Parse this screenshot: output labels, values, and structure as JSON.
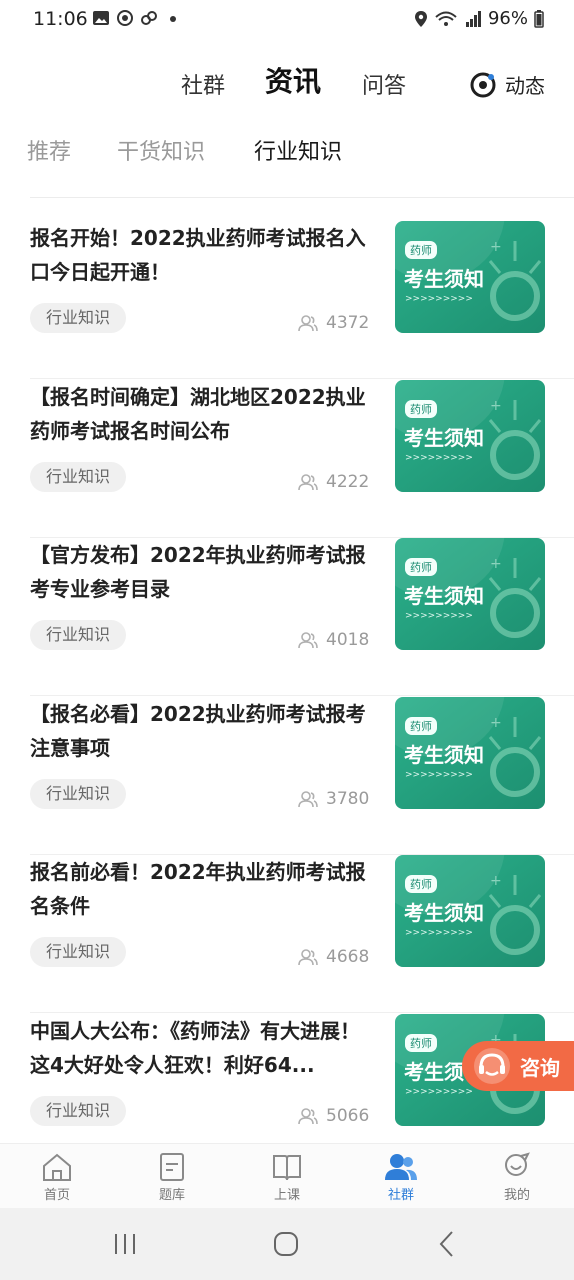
{
  "status_bar": {
    "time": "11:06",
    "battery": "96%"
  },
  "top_tabs": [
    {
      "label": "社群"
    },
    {
      "label": "资讯"
    },
    {
      "label": "问答"
    }
  ],
  "dynamic": {
    "label": "动态"
  },
  "sub_tabs": [
    {
      "label": "推荐"
    },
    {
      "label": "干货知识"
    },
    {
      "label": "行业知识"
    }
  ],
  "articles": [
    {
      "title": "报名开始！2022执业药师考试报名入口今日起开通！",
      "tag": "行业知识",
      "views": "4372",
      "thumb_badge": "药师",
      "thumb_text": "考生须知",
      "thumb_dots": ">>>>>>>>>"
    },
    {
      "title": "【报名时间确定】湖北地区2022执业药师考试报名时间公布",
      "tag": "行业知识",
      "views": "4222",
      "thumb_badge": "药师",
      "thumb_text": "考生须知",
      "thumb_dots": ">>>>>>>>>"
    },
    {
      "title": "【官方发布】2022年执业药师考试报考专业参考目录",
      "tag": "行业知识",
      "views": "4018",
      "thumb_badge": "药师",
      "thumb_text": "考生须知",
      "thumb_dots": ">>>>>>>>>"
    },
    {
      "title": "【报名必看】2022执业药师考试报考注意事项",
      "tag": "行业知识",
      "views": "3780",
      "thumb_badge": "药师",
      "thumb_text": "考生须知",
      "thumb_dots": ">>>>>>>>>"
    },
    {
      "title": "报名前必看！2022年执业药师考试报名条件",
      "tag": "行业知识",
      "views": "4668",
      "thumb_badge": "药师",
      "thumb_text": "考生须知",
      "thumb_dots": ">>>>>>>>>"
    },
    {
      "title": "中国人大公布：《药师法》有大进展！这4大好处令人狂欢！利好64...",
      "tag": "行业知识",
      "views": "5066",
      "thumb_badge": "药师",
      "thumb_text": "考生须",
      "thumb_dots": ">>>>>>>>>"
    }
  ],
  "consult": {
    "label": "咨询"
  },
  "bottom_nav": [
    {
      "label": "首页",
      "icon": "home-icon"
    },
    {
      "label": "题库",
      "icon": "question-bank-icon"
    },
    {
      "label": "上课",
      "icon": "book-icon"
    },
    {
      "label": "社群",
      "icon": "community-icon"
    },
    {
      "label": "我的",
      "icon": "profile-icon"
    }
  ],
  "colors": {
    "accent_green": "#27a783",
    "active_blue": "#2f7ed8",
    "consult_orange": "#f26a45"
  }
}
